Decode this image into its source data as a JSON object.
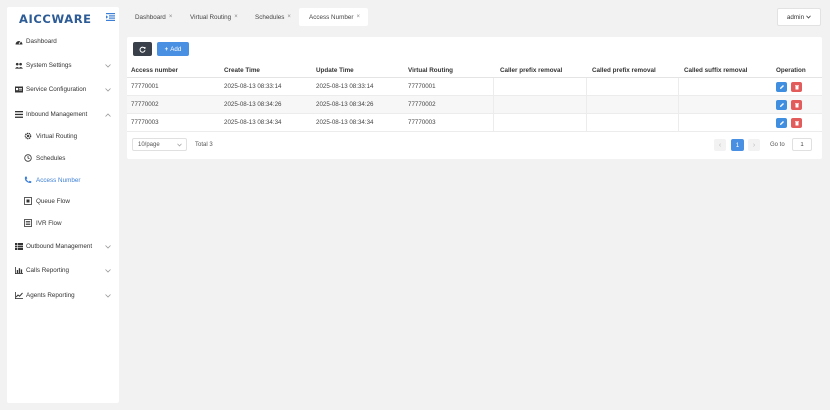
{
  "app": {
    "logo": "AICCWARE"
  },
  "sidebar": {
    "items": [
      {
        "label": "Dashboard"
      },
      {
        "label": "System Settings"
      },
      {
        "label": "Service Configuration"
      },
      {
        "label": "Inbound Management"
      },
      {
        "label": "Virtual Routing"
      },
      {
        "label": "Schedules"
      },
      {
        "label": "Access Number"
      },
      {
        "label": "Queue Flow"
      },
      {
        "label": "IVR Flow"
      },
      {
        "label": "Outbound Management"
      },
      {
        "label": "Calls Reporting"
      },
      {
        "label": "Agents Reporting"
      }
    ]
  },
  "tabs": [
    {
      "label": "Dashboard",
      "close": "×"
    },
    {
      "label": "Virtual Routing",
      "close": "×"
    },
    {
      "label": "Schedules",
      "close": "×"
    },
    {
      "label": "Access Number",
      "close": "×"
    }
  ],
  "user": {
    "name": "admin"
  },
  "toolbar": {
    "add_label": "Add"
  },
  "table": {
    "headers": [
      "Access number",
      "Create Time",
      "Update Time",
      "Virtual Routing",
      "Caller prefix removal",
      "Called prefix removal",
      "Called suffix removal",
      "Operation"
    ],
    "rows": [
      [
        "77770001",
        "2025-08-13 08:33:14",
        "2025-08-13 08:33:14",
        "77770001",
        "",
        "",
        ""
      ],
      [
        "77770002",
        "2025-08-13 08:34:26",
        "2025-08-13 08:34:26",
        "77770002",
        "",
        "",
        ""
      ],
      [
        "77770003",
        "2025-08-13 08:34:34",
        "2025-08-13 08:34:34",
        "77770003",
        "",
        "",
        ""
      ]
    ]
  },
  "pagination": {
    "page_size": "10/page",
    "total": "Total 3",
    "current_page": "1",
    "goto_label": "Go to",
    "goto_value": "1"
  },
  "colors": {
    "accent": "#4a90e2",
    "logo": "#2d5b96",
    "delete": "#e25c5c",
    "dark_button": "#3a4049"
  }
}
